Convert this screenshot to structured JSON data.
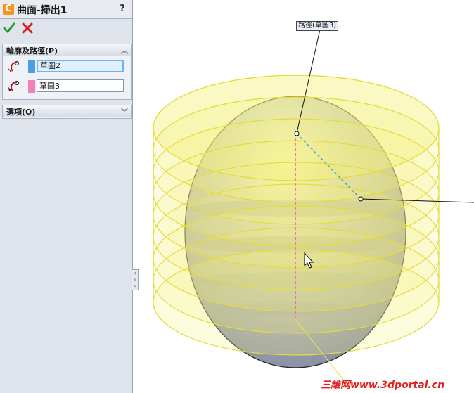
{
  "window": {
    "title": "曲面-掃出1",
    "title_icon": "C",
    "help_label": "?"
  },
  "actions": {
    "ok": "ok-check-icon",
    "cancel": "cancel-x-icon"
  },
  "groups": {
    "profile_path": {
      "label": "輪廓及路徑(P)",
      "toggle": "︽",
      "profile": {
        "value": "草圖2",
        "color": "#4a9ee8"
      },
      "path": {
        "value": "草圖3",
        "color": "#f080b8"
      }
    },
    "options": {
      "label": "選項(O)",
      "toggle": "︾"
    }
  },
  "viewport": {
    "callout": "路徑(草圖3)",
    "sweep_color": "#f4f27a",
    "solid_color": "#b8bccb"
  },
  "watermark": "三維网www.3dportal.cn"
}
